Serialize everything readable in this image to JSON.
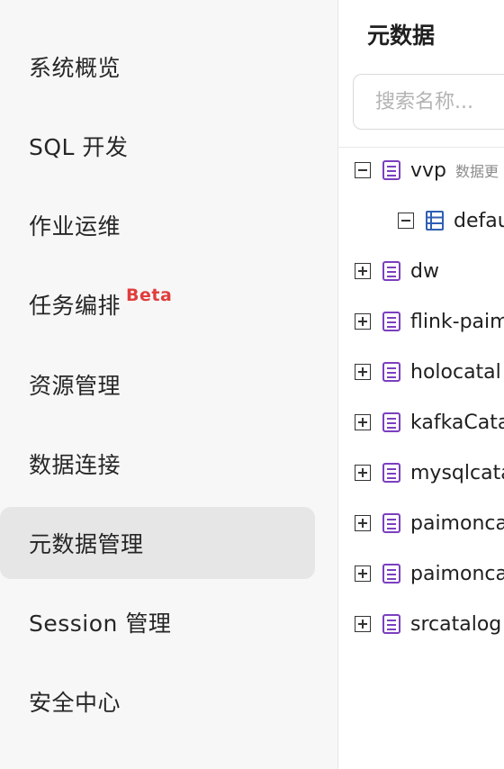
{
  "sidebar": {
    "items": [
      {
        "label": "系统概览"
      },
      {
        "label": "SQL 开发"
      },
      {
        "label": "作业运维"
      },
      {
        "label": "任务编排",
        "badge": "Beta"
      },
      {
        "label": "资源管理"
      },
      {
        "label": "数据连接"
      },
      {
        "label": "元数据管理"
      },
      {
        "label": "Session 管理"
      },
      {
        "label": "安全中心"
      }
    ],
    "active_index": 6
  },
  "panel": {
    "title": "元数据",
    "search": {
      "placeholder": "搜索名称...",
      "value": ""
    },
    "tree": [
      {
        "label": "vvp",
        "meta": "数据更",
        "expanded": true,
        "children": [
          {
            "label": "defau",
            "expanded": true,
            "type": "database"
          }
        ]
      },
      {
        "label": "dw",
        "expanded": false
      },
      {
        "label": "flink-paim",
        "expanded": false
      },
      {
        "label": "holocatal",
        "expanded": false
      },
      {
        "label": "kafkaCata",
        "expanded": false
      },
      {
        "label": "mysqlcata",
        "expanded": false
      },
      {
        "label": "paimonca",
        "expanded": false
      },
      {
        "label": "paimonca",
        "expanded": false
      },
      {
        "label": "srcatalog",
        "expanded": false
      }
    ]
  },
  "colors": {
    "catalog_icon": "#7b3fbf",
    "database_icon": "#2f5fb3",
    "beta_badge": "#e03d3d",
    "active_bg": "#e6e6e6"
  },
  "icons": {
    "catalog": "catalog-icon",
    "database": "database-icon"
  }
}
